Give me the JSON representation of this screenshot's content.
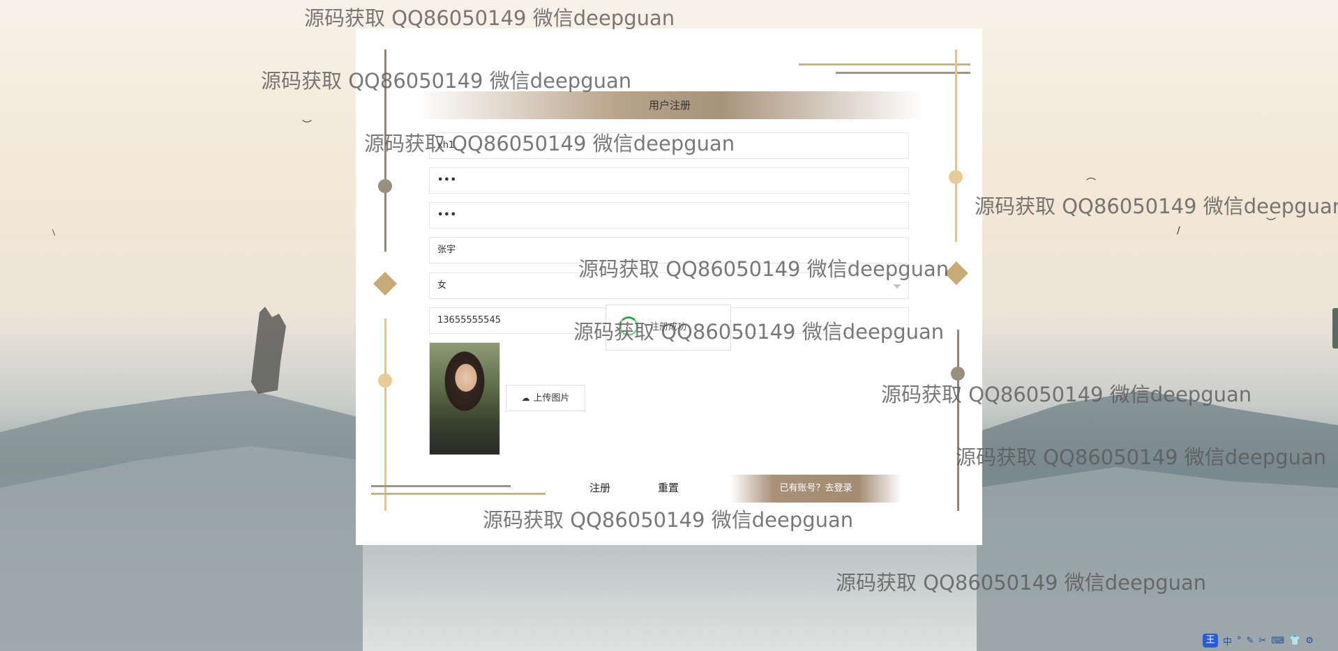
{
  "form": {
    "title": "用户注册",
    "fields": {
      "username": "xh1",
      "password": "•••",
      "confirm_password": "•••",
      "name": "张宇",
      "gender": "女",
      "phone": "13655555545"
    },
    "upload_label": "上传图片",
    "confirm_overlay_text": "注册成功",
    "register_label": "注册",
    "reset_label": "重置",
    "login_link_label": "已有账号？去登录"
  },
  "watermark": {
    "text": "源码获取 QQ86050149 微信deepguan"
  },
  "tray": {
    "ime_logo": "王",
    "items": [
      "中",
      "°",
      "✎",
      "✂",
      "⌨",
      "👕",
      "⚙"
    ]
  },
  "colors": {
    "accent_gold": "#e2c48c",
    "accent_brown": "#a8937a",
    "accent_gray": "#8f8578"
  },
  "icons": {
    "upload": "cloud-upload-icon",
    "spinner": "loading-spinner-icon"
  }
}
